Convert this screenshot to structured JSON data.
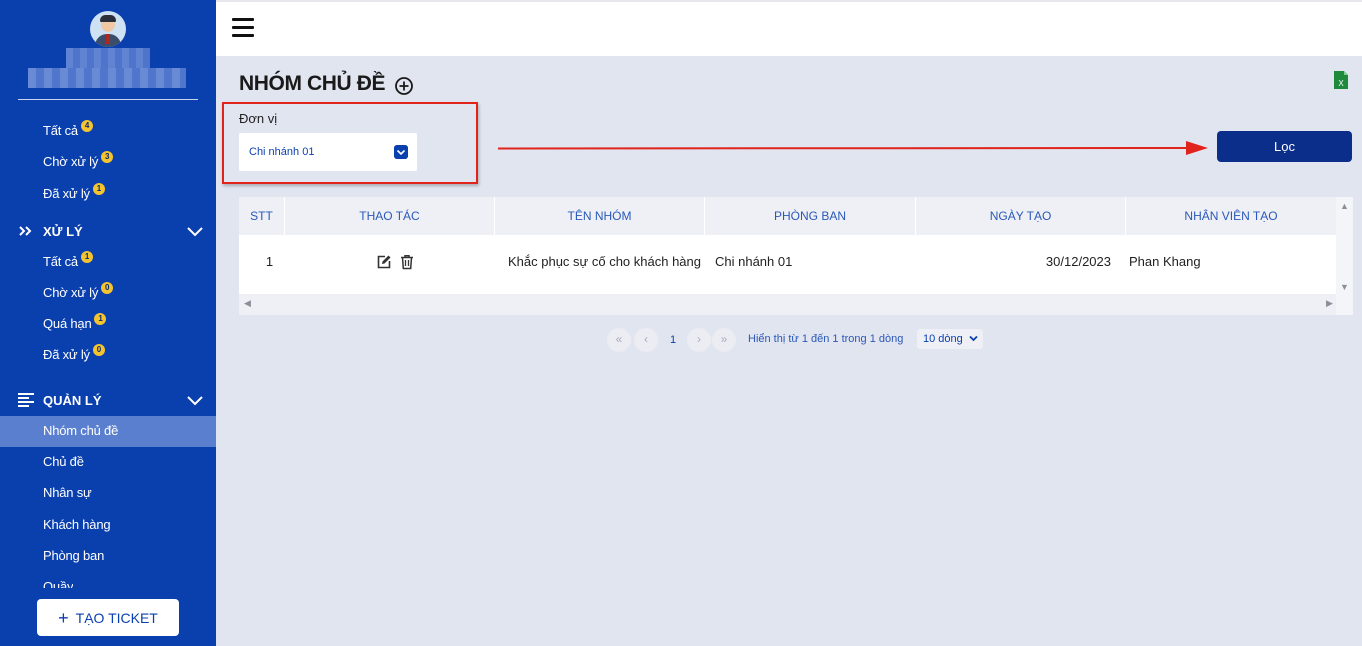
{
  "sidebar": {
    "status_items": [
      {
        "label": "Tất cả",
        "count": "4"
      },
      {
        "label": "Chờ xử lý",
        "count": "3"
      },
      {
        "label": "Đã xử lý",
        "count": "1"
      }
    ],
    "section_process": {
      "title": "XỬ LÝ",
      "items": [
        {
          "label": "Tất cả",
          "count": "1"
        },
        {
          "label": "Chờ xử lý",
          "count": "0"
        },
        {
          "label": "Quá hạn",
          "count": "1"
        },
        {
          "label": "Đã xử lý",
          "count": "0"
        }
      ]
    },
    "section_manage": {
      "title": "QUẢN LÝ",
      "items": [
        {
          "label": "Nhóm chủ đề",
          "active": true
        },
        {
          "label": "Chủ đề"
        },
        {
          "label": "Nhân sự"
        },
        {
          "label": "Khách hàng"
        },
        {
          "label": "Phòng ban"
        },
        {
          "label": "Quầy"
        }
      ]
    },
    "create_button": {
      "icon": "plus-icon",
      "label": "TẠO TICKET"
    }
  },
  "header": {
    "menu_icon": "hamburger-icon"
  },
  "page": {
    "title": "NHÓM CHỦ ĐỀ",
    "add_icon": "add-circle-icon",
    "export_icon": "excel-export-icon"
  },
  "filter": {
    "label": "Đơn vị",
    "selected": "Chi nhánh 01",
    "button_label": "Lọc"
  },
  "table": {
    "columns": [
      "STT",
      "THAO TÁC",
      "TÊN NHÓM",
      "PHÒNG BAN",
      "NGÀY TẠO",
      "NHÂN VIÊN TẠO"
    ],
    "rows": [
      {
        "stt": "1",
        "ten_nhom": "Khắc phục sự cố cho khách hàng",
        "phong_ban": "Chi nhánh 01",
        "ngay_tao": "30/12/2023",
        "nhan_vien": "Phan Khang"
      }
    ]
  },
  "pagination": {
    "first": "«",
    "prev": "‹",
    "current_page": "1",
    "next": "›",
    "last": "»",
    "info": "Hiển thị từ 1 đến 1 trong 1 dòng",
    "page_size": "10 dòng"
  },
  "colors": {
    "sidebar_bg": "#0a3fae",
    "active_item_bg": "#5b7fcf",
    "primary_button": "#0a2e8a",
    "badge": "#f4c430",
    "annotation_red": "#e0231b",
    "page_bg": "#e1e5f0"
  }
}
